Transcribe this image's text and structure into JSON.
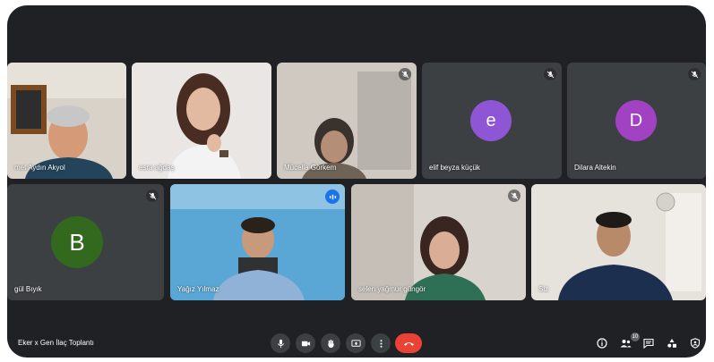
{
  "meeting": {
    "title": "Eker x Gen İlaç Toplantı"
  },
  "participants_badge": "10",
  "participants": [
    {
      "id": "p1",
      "name": "met Aydın Akyol"
    },
    {
      "id": "p2",
      "name": "esra ağdaş"
    },
    {
      "id": "p3",
      "name": "Mücella Görkem"
    },
    {
      "id": "p4",
      "name": "elif beyza küçük",
      "initial": "e",
      "avatar_color": "#8e55d4"
    },
    {
      "id": "p5",
      "name": "Dilara Altekin",
      "initial": "D",
      "avatar_color": "#a142c2"
    },
    {
      "id": "p6",
      "name": "gül Bıyık",
      "initial": "B",
      "avatar_color": "#33691e"
    },
    {
      "id": "p7",
      "name": "Yağız Yılmaz"
    },
    {
      "id": "p8",
      "name": "selen yağmur güngör"
    },
    {
      "id": "p9",
      "name": "Siz"
    }
  ],
  "controls": {
    "mic": "microphone-icon",
    "camera": "camera-icon",
    "hand": "raise-hand-icon",
    "present": "present-screen-icon",
    "more": "more-options-icon",
    "end": "end-call-icon"
  },
  "side_controls": [
    "info-icon",
    "people-icon",
    "chat-icon",
    "activities-icon",
    "host-controls-icon"
  ],
  "colors": {
    "background": "#202124",
    "tile": "#3c4043",
    "end_call": "#ea4335",
    "speaking": "#1a73e8"
  }
}
